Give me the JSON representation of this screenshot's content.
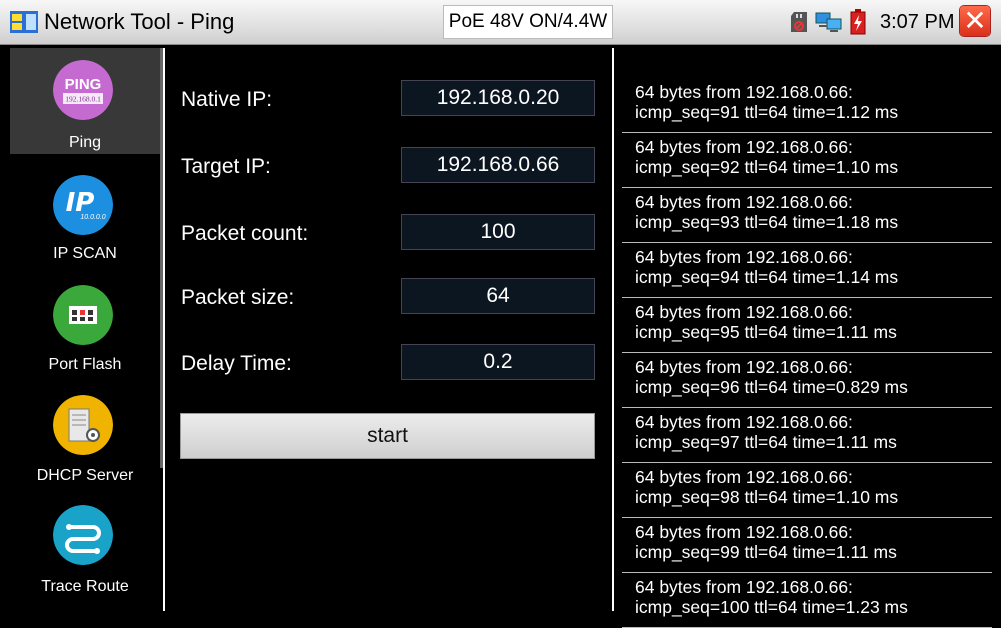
{
  "window": {
    "title": "Network Tool - Ping",
    "poe_status": "PoE 48V ON/4.4W",
    "clock": "3:07 PM"
  },
  "status_icons": [
    "sd-card-icon",
    "network-computers-icon",
    "battery-charging-icon"
  ],
  "sidebar": {
    "items": [
      {
        "label": "Ping",
        "icon": "ping-icon",
        "icon_text": "PING",
        "icon_subtext": "192.168.0.1",
        "color": "#c46ad0",
        "selected": true
      },
      {
        "label": "IP SCAN",
        "icon": "ip-scan-icon",
        "icon_text": "IP",
        "icon_subtext": "10.0.0.0",
        "color": "#1d8fe0",
        "selected": false
      },
      {
        "label": "Port Flash",
        "icon": "port-flash-icon",
        "color": "#3aa83a",
        "selected": false
      },
      {
        "label": "DHCP Server",
        "icon": "dhcp-server-icon",
        "color": "#f0b400",
        "selected": false
      },
      {
        "label": "Trace Route",
        "icon": "trace-route-icon",
        "color": "#1aa3c9",
        "selected": false
      }
    ]
  },
  "form": {
    "native_ip": {
      "label": "Native IP:",
      "value": "192.168.0.20"
    },
    "target_ip": {
      "label": "Target IP:",
      "value": "192.168.0.66"
    },
    "packet_count": {
      "label": "Packet count:",
      "value": "100"
    },
    "packet_size": {
      "label": "Packet size:",
      "value": "64"
    },
    "delay_time": {
      "label": "Delay Time:",
      "value": "0.2"
    },
    "start_label": "start"
  },
  "log": [
    {
      "line1": "64 bytes from 192.168.0.66:",
      "line2": "icmp_seq=91 ttl=64 time=1.12 ms"
    },
    {
      "line1": "64 bytes from 192.168.0.66:",
      "line2": "icmp_seq=92 ttl=64 time=1.10 ms"
    },
    {
      "line1": "64 bytes from 192.168.0.66:",
      "line2": "icmp_seq=93 ttl=64 time=1.18 ms"
    },
    {
      "line1": "64 bytes from 192.168.0.66:",
      "line2": "icmp_seq=94 ttl=64 time=1.14 ms"
    },
    {
      "line1": "64 bytes from 192.168.0.66:",
      "line2": "icmp_seq=95 ttl=64 time=1.11 ms"
    },
    {
      "line1": "64 bytes from 192.168.0.66:",
      "line2": "icmp_seq=96 ttl=64 time=0.829 ms"
    },
    {
      "line1": "64 bytes from 192.168.0.66:",
      "line2": "icmp_seq=97 ttl=64 time=1.11 ms"
    },
    {
      "line1": "64 bytes from 192.168.0.66:",
      "line2": "icmp_seq=98 ttl=64 time=1.10 ms"
    },
    {
      "line1": "64 bytes from 192.168.0.66:",
      "line2": "icmp_seq=99 ttl=64 time=1.11 ms"
    },
    {
      "line1": "64 bytes from 192.168.0.66:",
      "line2": "icmp_seq=100 ttl=64 time=1.23 ms"
    }
  ]
}
